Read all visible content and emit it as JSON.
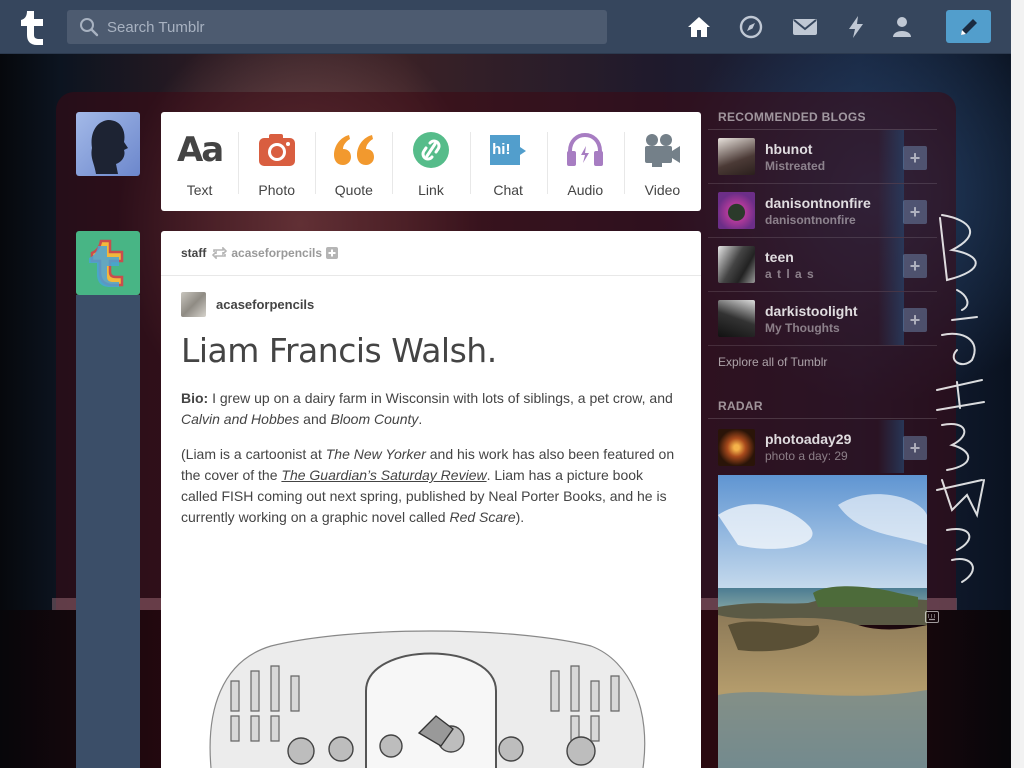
{
  "header": {
    "search": {
      "placeholder": "Search Tumblr"
    },
    "nav": [
      "home-icon",
      "explore-icon",
      "inbox-icon",
      "activity-icon",
      "account-icon"
    ],
    "compose_icon": "pencil-icon",
    "colors": {
      "bar": "#36465d",
      "compose": "#529ecc"
    }
  },
  "post_types": [
    {
      "label": "Text",
      "icon": "text-icon",
      "color": "#444444",
      "glyph": "Aa"
    },
    {
      "label": "Photo",
      "icon": "camera-icon",
      "color": "#d95e40"
    },
    {
      "label": "Quote",
      "icon": "quote-icon",
      "color": "#f2992e",
      "glyph": "“"
    },
    {
      "label": "Link",
      "icon": "link-icon",
      "color": "#56bc8a"
    },
    {
      "label": "Chat",
      "icon": "chat-icon",
      "color": "#529ecc",
      "glyph": "hi!"
    },
    {
      "label": "Audio",
      "icon": "headphones-icon",
      "color": "#a77dc2"
    },
    {
      "label": "Video",
      "icon": "video-camera-icon",
      "color": "#748089"
    }
  ],
  "post": {
    "reblogger": "staff",
    "via": "acaseforpencils",
    "source": "acaseforpencils",
    "title": "Liam Francis Walsh.",
    "bio_label": "Bio:",
    "bio_text": " I grew up on a dairy farm in Wisconsin with lots of siblings, a pet crow, and ",
    "bio_em1": "Calvin and Hobbes",
    "bio_and": " and ",
    "bio_em2": "Bloom County",
    "bio_end": ".",
    "p2_a": "(Liam is a cartoonist at ",
    "p2_em1": "The New Yorker",
    "p2_b": " and his work has also been featured on the cover of the ",
    "p2_link": "The Guardian’s Saturday Review",
    "p2_c": ". Liam has a picture book called FISH coming out next spring, published by Neal Porter Books, and he is currently working on a graphic novel called ",
    "p2_em2": "Red Scare",
    "p2_d": ")."
  },
  "sidebar": {
    "recommended_title": "RECOMMENDED BLOGS",
    "blogs": [
      {
        "name": "hbunot",
        "subtitle": "Mistreated"
      },
      {
        "name": "danisontnonfire",
        "subtitle": "danisontnonfire"
      },
      {
        "name": "teen",
        "subtitle": "a t l a s"
      },
      {
        "name": "darkistoolight",
        "subtitle": "My Thoughts"
      }
    ],
    "follow_label": "+",
    "explore": "Explore all of Tumblr",
    "radar_title": "RADAR",
    "radar": {
      "name": "photoaday29",
      "subtitle": "photo a day: 29"
    }
  }
}
